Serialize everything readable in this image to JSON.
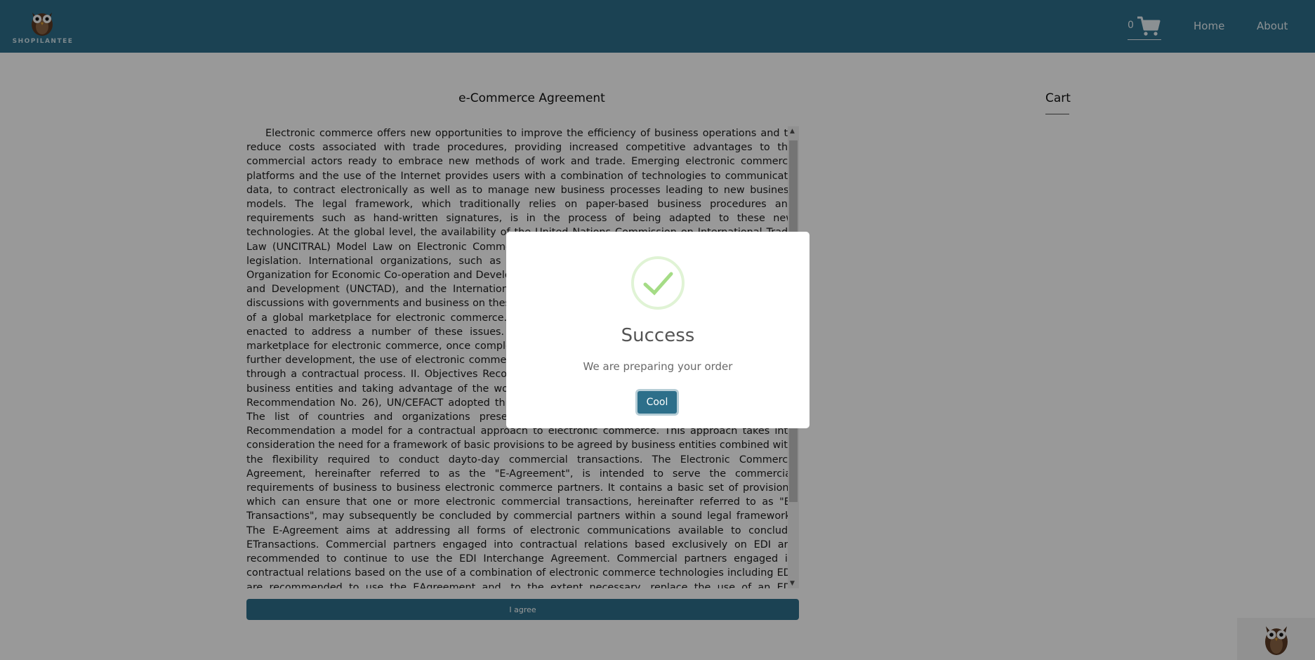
{
  "header": {
    "logo_text": "SHOPILANTEE",
    "cart_count": "0",
    "nav": {
      "home": "Home",
      "about": "About"
    }
  },
  "agreement": {
    "title": "e-Commerce Agreement",
    "text": "Electronic commerce offers new opportunities to improve the efficiency of business operations and to reduce costs associated with trade procedures, providing increased competitive advantages to the commercial actors ready to embrace new methods of work and trade. Emerging electronic commerce platforms and the use of the Internet provides users with a combination of technologies to communicate data, to contract electronically as well as to manage new business processes leading to new business models. The legal framework, which traditionally relies on paper-based business procedures and requirements such as hand-written signatures, is in the process of being adapted to these new technologies. At the global level, the availability of the United Nations Commission on International Trade Law (UNCITRAL) Model Law on Electronic Commerce adopted in 1996 provides a framework to adapt legislation. International organizations, such as the World Trade Organization (WTO), UNCITRAL, the Organization for Economic Co-operation and Development (OECD), the United Nations Conference on Trade and Development (UNCTAD), and the International Chamber of Commerce (ICC), are also involved in discussions with governments and business on these issues. These efforts will contribute to the emergence of a global marketplace for electronic commerce. At the national level, legislation is being proposed or enacted to address a number of these issues. However, a comprehensive legal framework for the marketplace for electronic commerce, once completed, is unlikely to provide the certainty required for its further development, the use of electronic commerce. These issues may, therefore, need to be addressed through a contractual process. II. Objectives Recognizing the need for a contractual framework between business entities and taking advantage of the work undertaken on the Interchange Agreement (UN/ECE Recommendation No. 26), UN/CEFACT adopted this Recommendation at its sixth session in March 2000. The list of countries and organizations present is available. UN/CEFACT is proposing with this Recommendation a model for a contractual approach to electronic commerce. This approach takes into consideration the need for a framework of basic provisions to be agreed by business entities combined with the flexibility required to conduct dayto-day commercial transactions. The Electronic Commerce Agreement, hereinafter referred to as the \"E-Agreement\", is intended to serve the commercial requirements of business to business electronic commerce partners. It contains a basic set of provisions which can ensure that one or more electronic commercial transactions, hereinafter referred to as \"E-Transactions\", may subsequently be concluded by commercial partners within a sound legal framework. The E-Agreement aims at addressing all forms of electronic communications available to conclude ETransactions. Commercial partners engaged into contractual relations based exclusively on EDI are recommended to continue to use the EDI Interchange Agreement. Commercial partners engaged in contractual relations based on the use of a combination of electronic commerce technologies including EDI are recommended to use the EAgreement and, to the extent necessary, replace the use of an EDI Interchange Agreement by the EAgreement. Limitations Though the E-Agreement could be used in relationships between businesses and consumers, it does not",
    "agree_button": "I agree"
  },
  "cart": {
    "title": "Cart"
  },
  "modal": {
    "title": "Success",
    "message": "We are preparing your order",
    "button": "Cool",
    "icon": "success-check-icon",
    "icon_color": "#a5dc86"
  },
  "colors": {
    "primary": "#2d6f8a",
    "overlay": "rgba(0,0,0,0.4)"
  }
}
